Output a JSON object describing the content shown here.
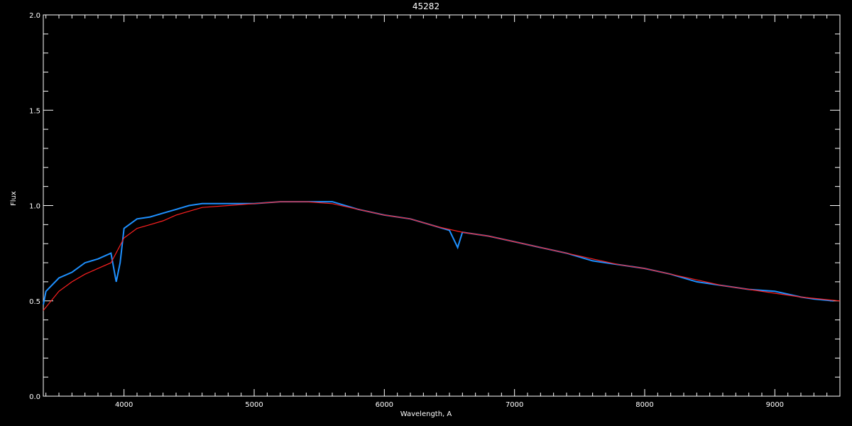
{
  "chart_data": {
    "type": "line",
    "title": "45282",
    "xlabel": "Wavelength, A",
    "ylabel": "Flux",
    "xlim": [
      3380,
      9500
    ],
    "ylim": [
      0.0,
      2.0
    ],
    "xticks": [
      4000,
      5000,
      6000,
      7000,
      8000,
      9000
    ],
    "yticks": [
      0.0,
      0.5,
      1.0,
      1.5,
      2.0
    ],
    "ytick_labels": [
      "0.0",
      "0.5",
      "1.0",
      "1.5",
      "2.0"
    ],
    "grid": false,
    "colors": {
      "background": "#000000",
      "axes": "#ffffff",
      "observed": "#1e90ff",
      "model": "#ff2020",
      "reference": "#ffffff"
    },
    "series": [
      {
        "role": "observed",
        "color": "#1e90ff",
        "x": [
          3380,
          3400,
          3500,
          3600,
          3700,
          3800,
          3900,
          3940,
          3970,
          4000,
          4100,
          4200,
          4300,
          4400,
          4500,
          4600,
          4700,
          4800,
          4900,
          5000,
          5200,
          5400,
          5600,
          5800,
          6000,
          6200,
          6400,
          6500,
          6563,
          6600,
          6800,
          7000,
          7200,
          7400,
          7600,
          7800,
          8000,
          8200,
          8400,
          8600,
          8800,
          9000,
          9200,
          9300,
          9450
        ],
        "y": [
          0.48,
          0.55,
          0.62,
          0.65,
          0.7,
          0.72,
          0.75,
          0.6,
          0.7,
          0.88,
          0.93,
          0.94,
          0.96,
          0.98,
          1.0,
          1.01,
          1.01,
          1.01,
          1.01,
          1.01,
          1.02,
          1.02,
          1.02,
          0.98,
          0.95,
          0.93,
          0.89,
          0.87,
          0.78,
          0.86,
          0.84,
          0.81,
          0.78,
          0.75,
          0.71,
          0.69,
          0.67,
          0.64,
          0.6,
          0.58,
          0.56,
          0.55,
          0.52,
          0.51,
          0.5
        ]
      },
      {
        "role": "model",
        "color": "#ff2020",
        "x": [
          3380,
          3500,
          3600,
          3700,
          3800,
          3900,
          4000,
          4100,
          4200,
          4300,
          4400,
          4500,
          4600,
          4800,
          5000,
          5200,
          5400,
          5600,
          5800,
          6000,
          6200,
          6400,
          6600,
          6800,
          7000,
          7200,
          7400,
          7600,
          7800,
          8000,
          8200,
          8400,
          8600,
          8800,
          9000,
          9200,
          9500
        ],
        "y": [
          0.45,
          0.55,
          0.6,
          0.64,
          0.67,
          0.7,
          0.83,
          0.88,
          0.9,
          0.92,
          0.95,
          0.97,
          0.99,
          1.0,
          1.01,
          1.02,
          1.02,
          1.01,
          0.98,
          0.95,
          0.93,
          0.89,
          0.86,
          0.84,
          0.81,
          0.78,
          0.75,
          0.72,
          0.69,
          0.67,
          0.64,
          0.61,
          0.58,
          0.56,
          0.54,
          0.52,
          0.5
        ]
      }
    ]
  }
}
